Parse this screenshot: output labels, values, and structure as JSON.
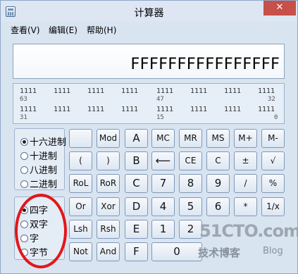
{
  "titlebar": {
    "title": "计算器",
    "minimize": "—",
    "maximize": "□",
    "close": "✕"
  },
  "menu": [
    "查看(V)",
    "编辑(E)",
    "帮助(H)"
  ],
  "display": {
    "value": "FFFFFFFFFFFFFFFF"
  },
  "binary": {
    "row1_bits": [
      "1111",
      "1111",
      "1111",
      "1111",
      "1111",
      "1111",
      "1111",
      "1111"
    ],
    "row1_positions": [
      "63",
      "47",
      "32"
    ],
    "row2_bits": [
      "1111",
      "1111",
      "1111",
      "1111",
      "1111",
      "1111",
      "1111",
      "1111"
    ],
    "row2_positions": [
      "31",
      "15",
      "0"
    ]
  },
  "base_radios": [
    {
      "label": "十六进制",
      "selected": true
    },
    {
      "label": "十进制",
      "selected": false
    },
    {
      "label": "八进制",
      "selected": false
    },
    {
      "label": "二进制",
      "selected": false
    }
  ],
  "word_radios": [
    {
      "label": "四字",
      "selected": true
    },
    {
      "label": "双字",
      "selected": false
    },
    {
      "label": "字",
      "selected": false
    },
    {
      "label": "字节",
      "selected": false
    }
  ],
  "keys": {
    "mod": "Mod",
    "A": "A",
    "MC": "MC",
    "MR": "MR",
    "MS": "MS",
    "Mplus": "M+",
    "Mminus": "M-",
    "lparen": "(",
    "rparen": ")",
    "B": "B",
    "backspace": "⟵",
    "CE": "CE",
    "C": "C",
    "plusminus": "±",
    "sqrt": "√",
    "RoL": "RoL",
    "RoR": "RoR",
    "Ckey": "C",
    "seven": "7",
    "eight": "8",
    "nine": "9",
    "divide": "/",
    "percent": "%",
    "Or": "Or",
    "Xor": "Xor",
    "D": "D",
    "four": "4",
    "five": "5",
    "six": "6",
    "multiply": "*",
    "reciprocal": "1/x",
    "Lsh": "Lsh",
    "Rsh": "Rsh",
    "E": "E",
    "one": "1",
    "two": "2",
    "Not": "Not",
    "And": "And",
    "F": "F",
    "zero": "0"
  },
  "annotation_color": "#e3161b",
  "watermark": {
    "line1": "51CTO.com",
    "line2": "技术博客",
    "line3": "Blog"
  }
}
